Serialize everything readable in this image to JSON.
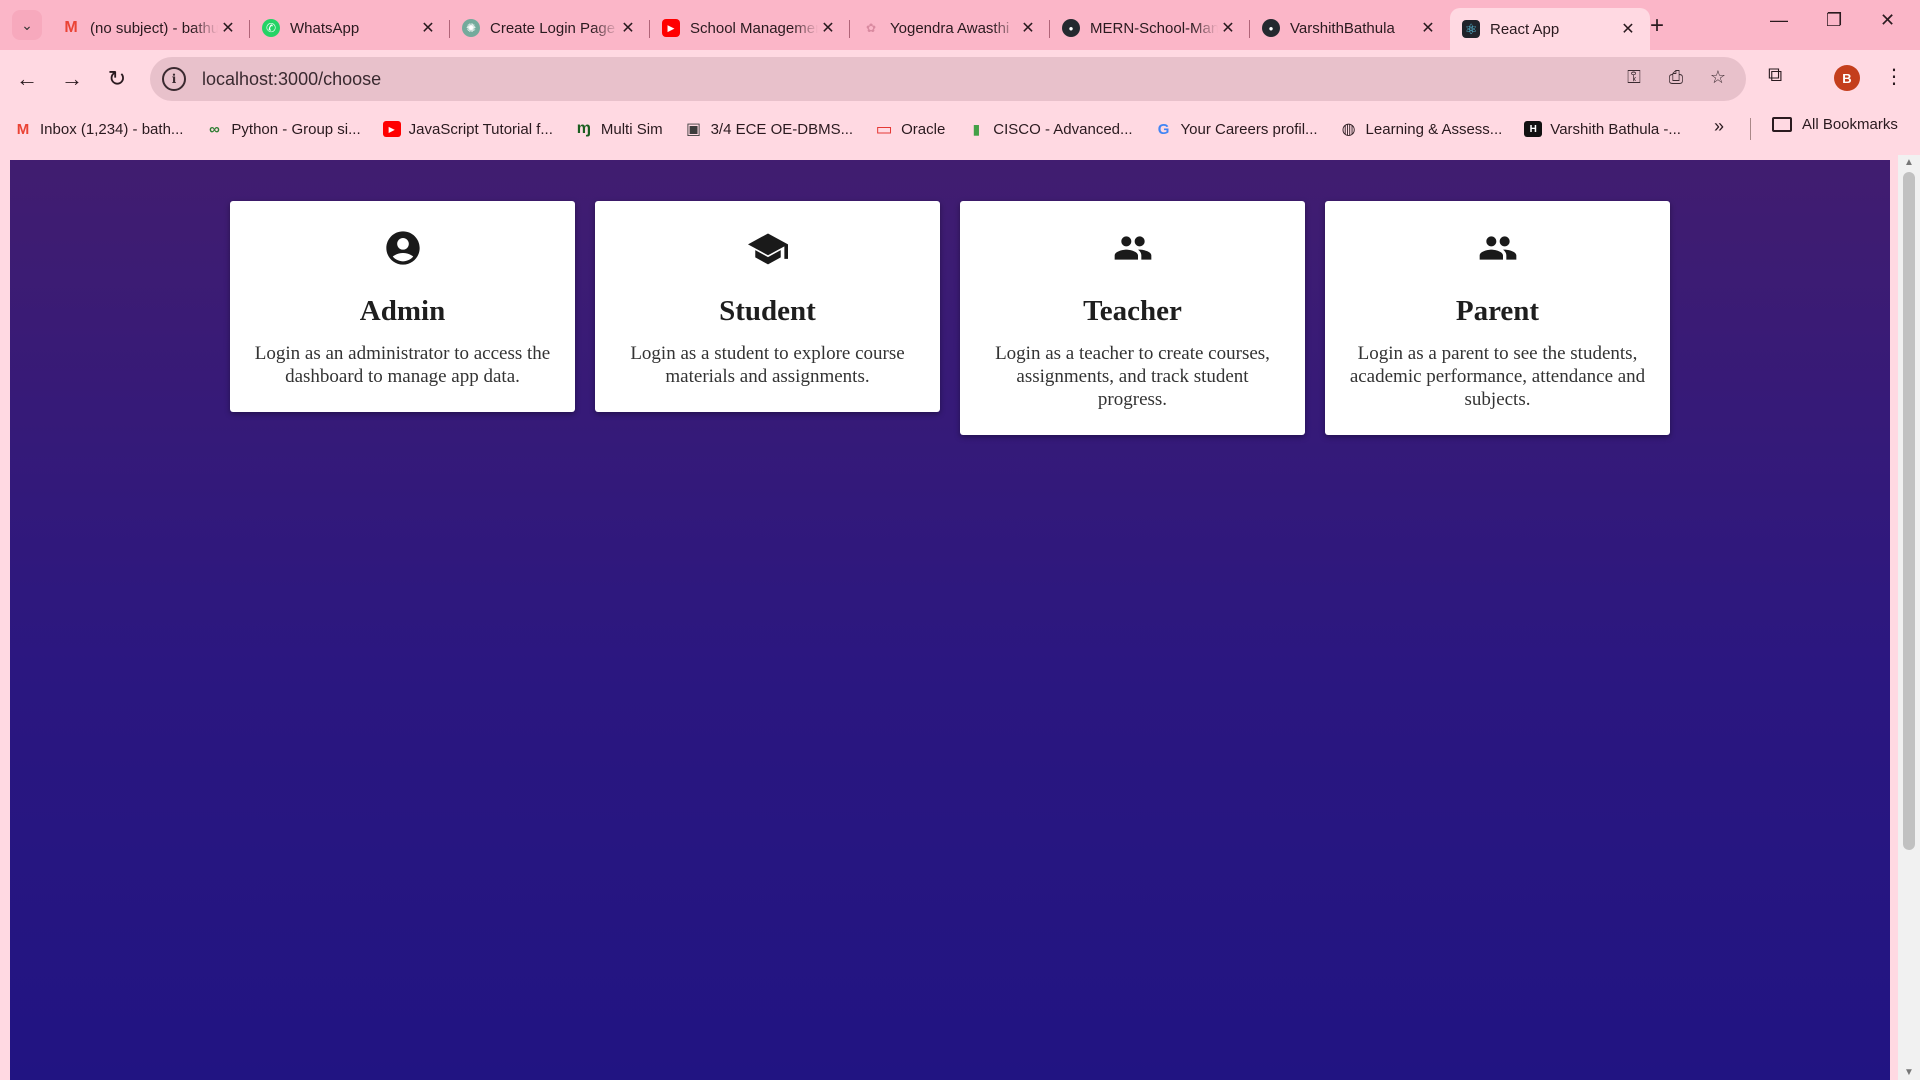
{
  "browser": {
    "tabs": [
      {
        "title": "(no subject) - bathula",
        "favicon": "gmail-icon",
        "color": "#ea4335",
        "glyph": "M"
      },
      {
        "title": "WhatsApp",
        "favicon": "whatsapp-icon",
        "color": "#25d366",
        "glyph": "✆"
      },
      {
        "title": "Create Login Page",
        "favicon": "chatgpt-icon",
        "color": "#74aa9c",
        "glyph": "✺"
      },
      {
        "title": "School Management",
        "favicon": "youtube-icon",
        "color": "#ff0000",
        "glyph": "▶"
      },
      {
        "title": "Yogendra Awasthi",
        "favicon": "profile-icon",
        "color": "#e7a0b2",
        "glyph": "✿"
      },
      {
        "title": "MERN-School-Management",
        "favicon": "github-icon",
        "color": "#24292f",
        "glyph": "●"
      },
      {
        "title": "VarshithBathula",
        "favicon": "github-icon",
        "color": "#24292f",
        "glyph": "●"
      },
      {
        "title": "React App",
        "favicon": "react-icon",
        "color": "#20232a",
        "glyph": "⚛",
        "active": true
      }
    ],
    "new_tab": "+",
    "url": "localhost:3000/choose",
    "profile_initial": "B",
    "bookmarks": [
      {
        "label": "Inbox (1,234) - bath...",
        "icon": "gmail-icon",
        "color": "#ea4335",
        "glyph": "M"
      },
      {
        "label": "Python - Group si...",
        "icon": "link-icon",
        "color": "#2e7d32",
        "glyph": "∞"
      },
      {
        "label": "JavaScript Tutorial f...",
        "icon": "youtube-icon",
        "color": "#ff0000",
        "glyph": "▶"
      },
      {
        "label": "Multi Sim",
        "icon": "multisim-icon",
        "color": "#1b5e20",
        "glyph": "ɱ"
      },
      {
        "label": "3/4 ECE OE-DBMS...",
        "icon": "classroom-icon",
        "color": "#3c3c3c",
        "glyph": "▣"
      },
      {
        "label": "Oracle",
        "icon": "oracle-icon",
        "color": "#e53935",
        "glyph": "▭"
      },
      {
        "label": "CISCO - Advanced...",
        "icon": "chart-icon",
        "color": "#43a047",
        "glyph": "▮"
      },
      {
        "label": "Your Careers profil...",
        "icon": "google-icon",
        "color": "#4285f4",
        "glyph": "G"
      },
      {
        "label": "Learning & Assess...",
        "icon": "globe-icon",
        "color": "#2a1a1f",
        "glyph": "◍"
      },
      {
        "label": "Varshith Bathula -...",
        "icon": "hackerrank-icon",
        "color": "#111111",
        "glyph": "H"
      }
    ],
    "more_bookmarks": "»",
    "all_bookmarks": "All Bookmarks"
  },
  "page": {
    "cards": [
      {
        "title": "Admin",
        "icon": "account-circle-icon",
        "description": "Login as an administrator to access the dashboard to manage app data."
      },
      {
        "title": "Student",
        "icon": "graduation-cap-icon",
        "description": "Login as a student to explore course materials and assignments."
      },
      {
        "title": "Teacher",
        "icon": "people-icon",
        "description": "Login as a teacher to create courses, assignments, and track student progress."
      },
      {
        "title": "Parent",
        "icon": "people-icon",
        "description": "Login as a parent to see the students, academic performance, attendance and subjects."
      }
    ]
  },
  "colors": {
    "tabstrip": "#fbb6c8",
    "toolbar": "#ffd9e2",
    "page_top": "#411d70",
    "page_bottom": "#211482",
    "card": "#ffffff"
  }
}
